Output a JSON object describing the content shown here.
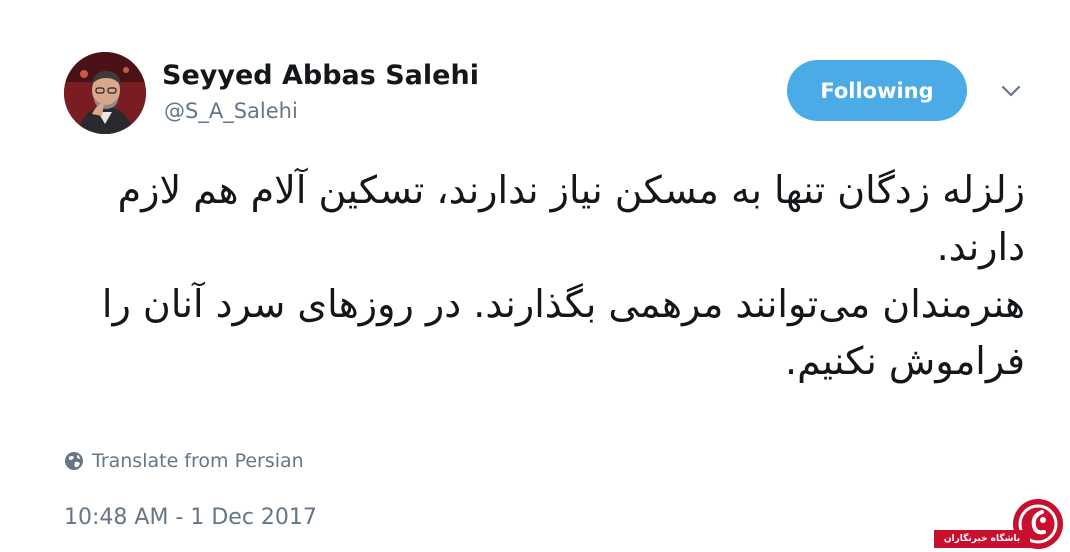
{
  "tweet": {
    "author": {
      "name": "Seyyed Abbas Salehi",
      "handle": "@S_A_Salehi"
    },
    "follow_label": "Following",
    "text_lines": [
      "زلزله زدگان تنها به مسکن نیاز ندارند، تسکین آلام هم لازم",
      "دارند.",
      "هنرمندان می‌توانند مرهمی بگذارند. در روزهای سرد آنان را",
      "فراموش نکنیم."
    ],
    "translate_label": "Translate from Persian",
    "timestamp": "10:48 AM - 1 Dec 2017"
  },
  "watermark": {
    "label": "باشگاه خبرنگاران"
  },
  "colors": {
    "accent": "#4aabe7",
    "secondary_text": "#657786",
    "primary_text": "#14171a",
    "watermark_red": "#c8102e"
  },
  "icons": {
    "translate": "globe-icon",
    "menu": "chevron-down-icon"
  }
}
